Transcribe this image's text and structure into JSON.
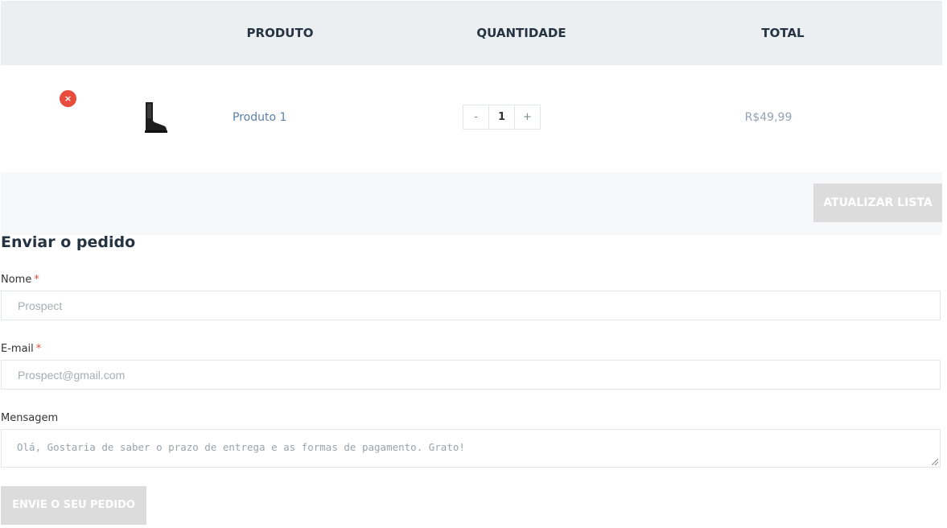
{
  "table": {
    "headers": {
      "product": "PRODUTO",
      "quantity": "QUANTIDADE",
      "total": "TOTAL"
    },
    "row": {
      "remove_symbol": "×",
      "product_name": "Produto 1",
      "qty_minus": "-",
      "qty_value": "1",
      "qty_plus": "+",
      "price": "R$49,99",
      "thumbnail_icon": "boot-icon"
    }
  },
  "actions": {
    "update_label": "ATUALIZAR LISTA"
  },
  "form": {
    "title": "Enviar o pedido",
    "name": {
      "label": "Nome",
      "required_mark": "*",
      "value": "Prospect"
    },
    "email": {
      "label": "E-mail",
      "required_mark": "*",
      "value": "Prospect@gmail.com"
    },
    "message": {
      "label": "Mensagem",
      "value": "Olá, Gostaria de saber o prazo de entrega e as formas de pagamento. Grato!"
    },
    "submit_label": "ENVIE O SEU PEDIDO"
  },
  "colors": {
    "remove": "#e74c3c",
    "link": "#5b7fa8",
    "button_disabled": "#dcdcdc",
    "header_bg": "#eceff1"
  }
}
